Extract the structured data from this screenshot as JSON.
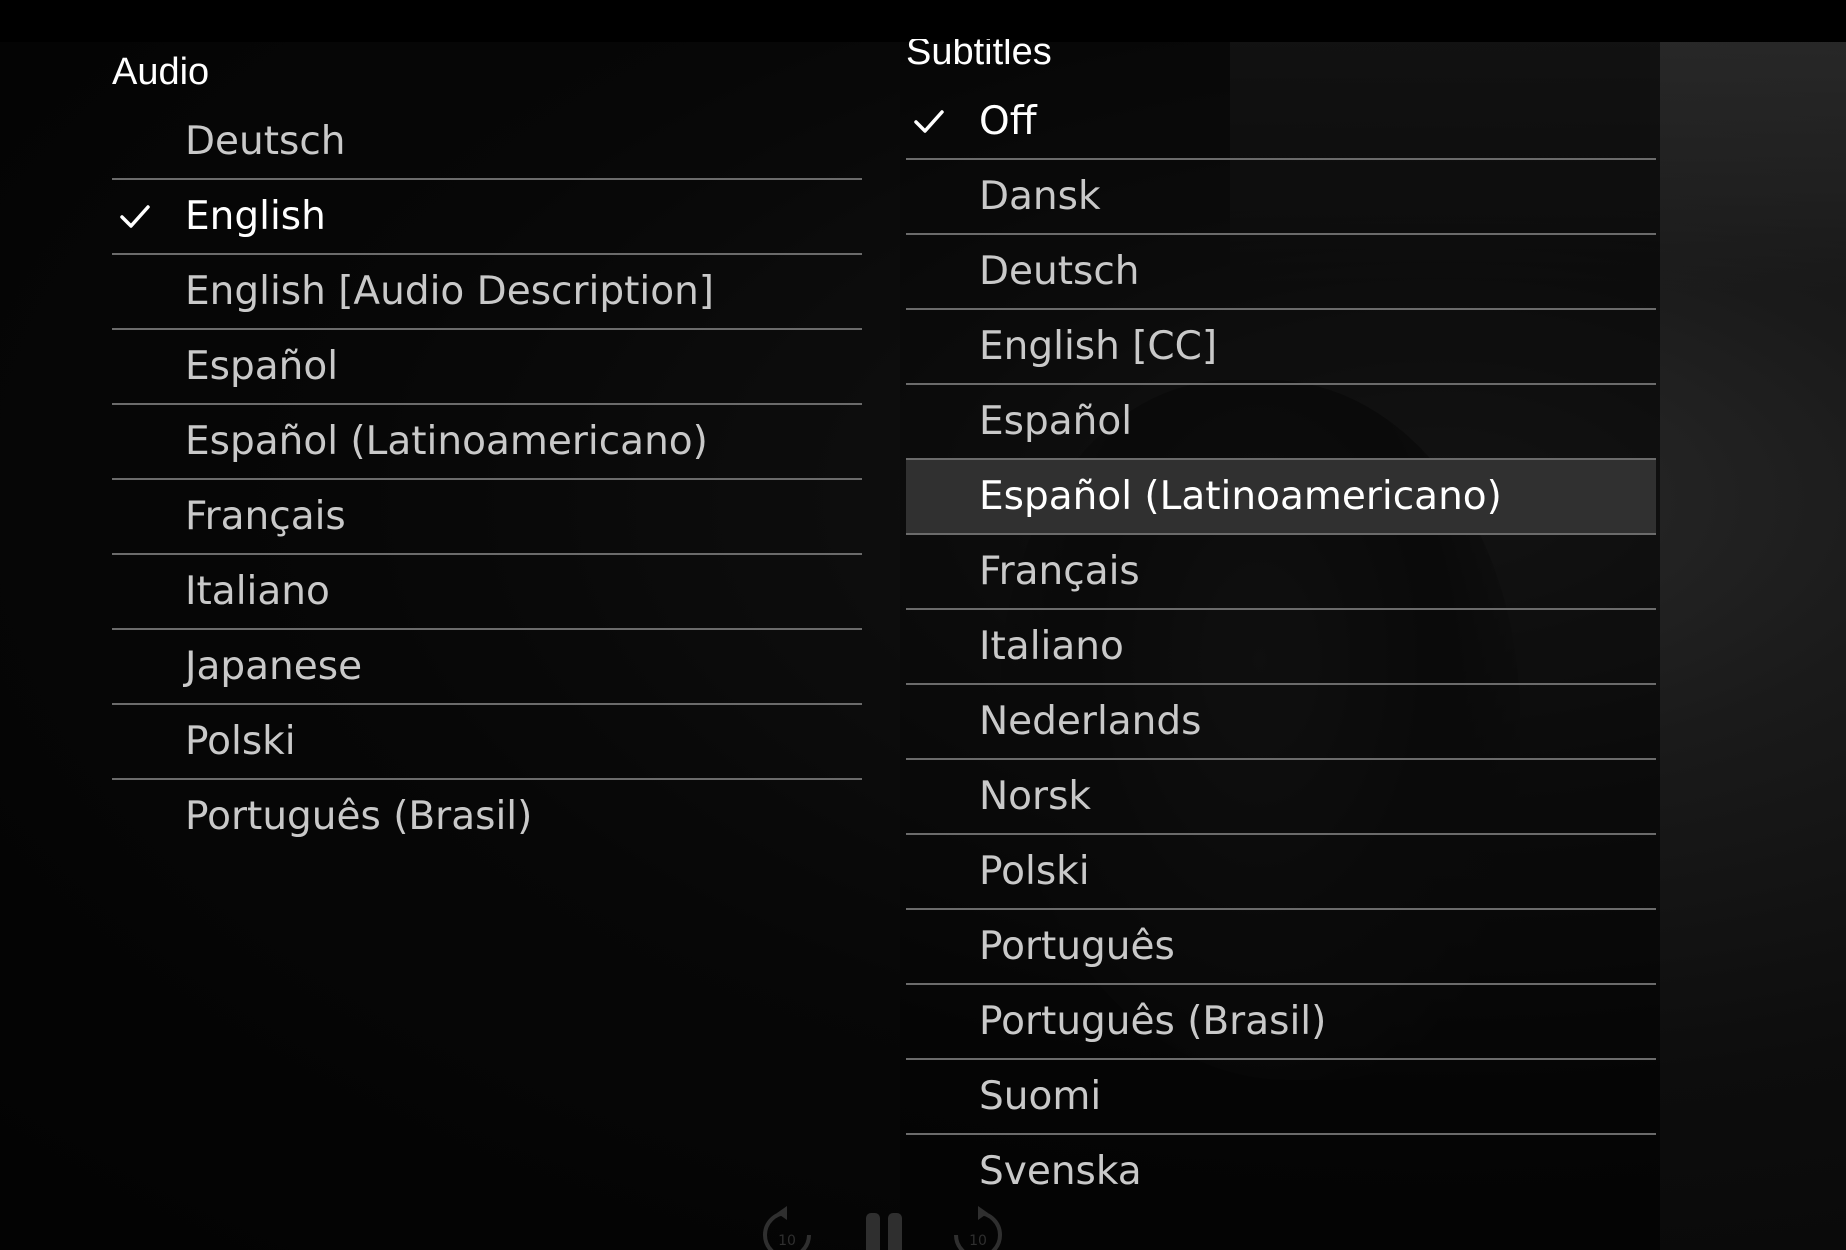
{
  "audio": {
    "title": "Audio",
    "items": [
      {
        "label": "Deutsch",
        "selected": false
      },
      {
        "label": "English",
        "selected": true
      },
      {
        "label": "English [Audio Description]",
        "selected": false
      },
      {
        "label": "Español",
        "selected": false
      },
      {
        "label": "Español (Latinoamericano)",
        "selected": false
      },
      {
        "label": "Français",
        "selected": false
      },
      {
        "label": "Italiano",
        "selected": false
      },
      {
        "label": "Japanese",
        "selected": false
      },
      {
        "label": "Polski",
        "selected": false
      },
      {
        "label": "Português (Brasil)",
        "selected": false
      }
    ]
  },
  "subtitles": {
    "title": "Subtitles",
    "items": [
      {
        "label": "Off",
        "selected": true
      },
      {
        "label": "Dansk",
        "selected": false
      },
      {
        "label": "Deutsch",
        "selected": false
      },
      {
        "label": "English [CC]",
        "selected": false
      },
      {
        "label": "Español",
        "selected": false
      },
      {
        "label": "Español (Latinoamericano)",
        "selected": false,
        "highlighted": true
      },
      {
        "label": "Français",
        "selected": false
      },
      {
        "label": "Italiano",
        "selected": false
      },
      {
        "label": "Nederlands",
        "selected": false
      },
      {
        "label": "Norsk",
        "selected": false
      },
      {
        "label": "Polski",
        "selected": false
      },
      {
        "label": "Português",
        "selected": false
      },
      {
        "label": "Português (Brasil)",
        "selected": false
      },
      {
        "label": "Suomi",
        "selected": false
      },
      {
        "label": "Svenska",
        "selected": false
      }
    ]
  },
  "controls": {
    "rewind_seconds": "10",
    "forward_seconds": "10",
    "rewind_icon": "rewind-10-icon",
    "pause_icon": "pause-icon",
    "forward_icon": "forward-10-icon"
  },
  "colors": {
    "background": "#050505",
    "text_active": "#ffffff",
    "text_inactive": "#c9c9c9",
    "divider": "#6b6b6b",
    "highlight_row": "#303030"
  }
}
